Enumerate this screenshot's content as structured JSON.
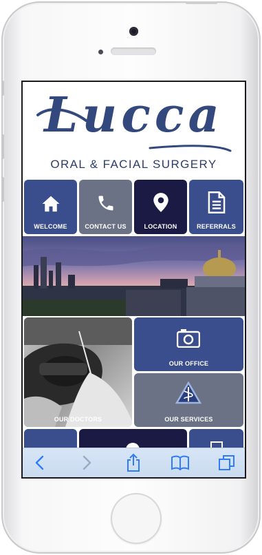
{
  "brand": {
    "script_name": "Lucca",
    "tagline": "ORAL & FACIAL SURGERY"
  },
  "tiles": {
    "welcome": {
      "label": "WELCOME",
      "icon": "home-icon"
    },
    "contact": {
      "label": "CONTACT US",
      "icon": "phone-icon"
    },
    "location": {
      "label": "LOCATION",
      "icon": "map-pin-icon"
    },
    "referrals": {
      "label": "REFERRALS",
      "icon": "document-icon"
    },
    "doctors": {
      "label": "OUR DOCTORS"
    },
    "office": {
      "label": "OUR OFFICE",
      "icon": "camera-icon"
    },
    "services": {
      "label": "OUR SERVICES",
      "icon": "caduceus-triangle-icon"
    }
  },
  "browser": {
    "buttons": [
      "back-icon",
      "forward-icon",
      "share-icon",
      "bookmarks-icon",
      "tabs-icon"
    ]
  },
  "colors": {
    "navy": "#3a4d8c",
    "gray": "#6b7286",
    "dark": "#1a1a45",
    "brand": "#33497e"
  }
}
